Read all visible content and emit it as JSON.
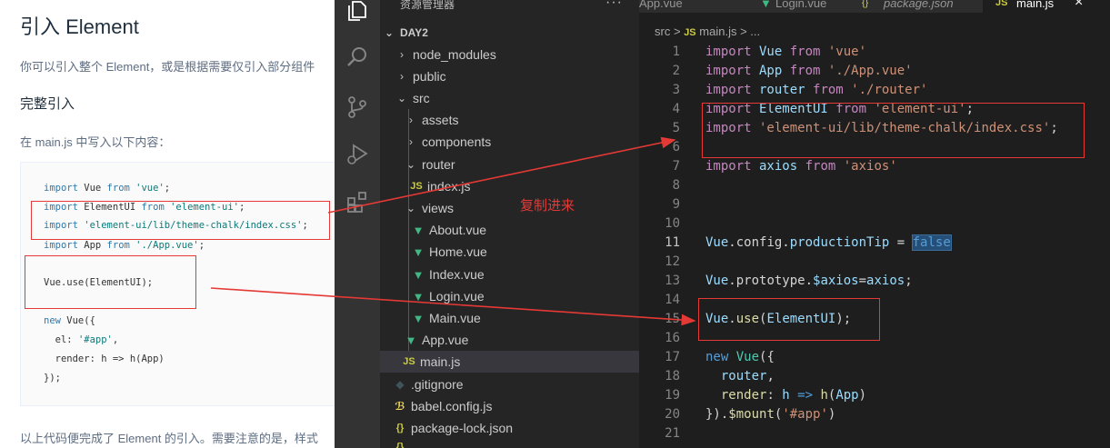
{
  "doc": {
    "title": "引入 Element",
    "intro": "你可以引入整个 Element，或是根据需要仅引入部分组件",
    "section": "完整引入",
    "instruction": "在 main.js 中写入以下内容：",
    "code": {
      "l1": {
        "kw1": "import",
        "mid": " Vue ",
        "kw2": "from",
        "str": " 'vue'",
        "end": ";"
      },
      "l2": {
        "kw1": "import",
        "mid": " ElementUI ",
        "kw2": "from",
        "str": " 'element-ui'",
        "end": ";"
      },
      "l3": {
        "kw1": "import",
        "str": " 'element-ui/lib/theme-chalk/index.css'",
        "end": ";"
      },
      "l4": {
        "kw1": "import",
        "mid": " App ",
        "kw2": "from",
        "str": " './App.vue'",
        "end": ";"
      },
      "l5": "Vue.use(ElementUI);",
      "l6": {
        "kw1": "new",
        "mid": " Vue({"
      },
      "l7": {
        "pre": "  el: ",
        "str": "'#app'",
        "end": ","
      },
      "l8": "  render: h => h(App)",
      "l9": "});"
    },
    "footer": "以上代码便完成了 Element 的引入。需要注意的是，样式"
  },
  "annotation": "复制进来",
  "explorer": {
    "title": "资源管理器",
    "more": "···",
    "root": "DAY2",
    "items": {
      "node_modules": "node_modules",
      "public": "public",
      "src": "src",
      "assets": "assets",
      "components": "components",
      "router": "router",
      "router_index": "index.js",
      "views": "views",
      "about": "About.vue",
      "home": "Home.vue",
      "index_vue": "Index.vue",
      "login": "Login.vue",
      "main_vue": "Main.vue",
      "app": "App.vue",
      "main_js": "main.js",
      "gitignore": ".gitignore",
      "babel": "babel.config.js",
      "package_lock": "package-lock.json"
    }
  },
  "tabs": {
    "t1": "App.vue",
    "t2": "Login.vue",
    "t3": "package.json",
    "t4": "main.js",
    "close": "×"
  },
  "breadcrumb": {
    "folder": "src",
    "sep": ">",
    "file": "main.js",
    "more": "> ..."
  },
  "editor": {
    "lines": [
      "1",
      "2",
      "3",
      "4",
      "5",
      "6",
      "7",
      "8",
      "9",
      "10",
      "11",
      "12",
      "13",
      "14",
      "15",
      "16",
      "17",
      "18",
      "19",
      "20",
      "21"
    ],
    "c1": {
      "k": "import",
      "v": " Vue ",
      "k2": "from",
      "s": " 'vue'"
    },
    "c2": {
      "k": "import",
      "v": " App ",
      "k2": "from",
      "s": " './App.vue'"
    },
    "c3": {
      "k": "import",
      "v": " router ",
      "k2": "from",
      "s": " './router'"
    },
    "c4": {
      "k": "import",
      "v": " ElementUI ",
      "k2": "from",
      "s": " 'element-ui'",
      "e": ";"
    },
    "c5": {
      "k": "import",
      "s": " 'element-ui/lib/theme-chalk/index.css'",
      "e": ";"
    },
    "c7": {
      "k": "import",
      "v": " axios ",
      "k2": "from",
      "s": " 'axios'"
    },
    "c11": {
      "a": "Vue",
      "b": ".config.",
      "c": "productionTip",
      "d": " = ",
      "e": "false"
    },
    "c13": {
      "a": "Vue",
      "b": ".prototype.",
      "c": "$axios",
      "d": "=",
      "e": "axios",
      "f": ";"
    },
    "c15": {
      "a": "Vue",
      "b": ".",
      "c": "use",
      "d": "(",
      "e": "ElementUI",
      "f": ");"
    },
    "c17": {
      "k": "new",
      "a": " ",
      "c": "Vue",
      "d": "({"
    },
    "c18": {
      "a": "  ",
      "v": "router",
      "b": ","
    },
    "c19": {
      "a": "  ",
      "v": "render",
      "b": ": ",
      "h": "h",
      "arrow": " => ",
      "f": "h",
      "p": "(",
      "app": "App",
      "e": ")"
    },
    "c20": {
      "a": "}).",
      "f": "$mount",
      "p": "(",
      "s": "'#app'",
      "e": ")"
    }
  },
  "colors": {
    "annotation_red": "#e53935",
    "vue_green": "#41b883",
    "js_yellow": "#cbcb41",
    "keyword_blue": "#569cd6"
  }
}
